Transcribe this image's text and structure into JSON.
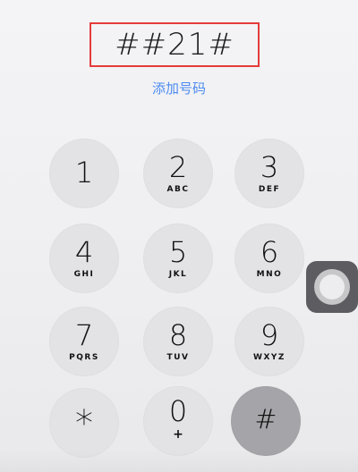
{
  "display": {
    "number": "##21#",
    "add_number_label": "添加号码"
  },
  "keypad": {
    "keys": [
      {
        "digit": "1",
        "letters": ""
      },
      {
        "digit": "2",
        "letters": "ABC"
      },
      {
        "digit": "3",
        "letters": "DEF"
      },
      {
        "digit": "4",
        "letters": "GHI"
      },
      {
        "digit": "5",
        "letters": "JKL"
      },
      {
        "digit": "6",
        "letters": "MNO"
      },
      {
        "digit": "7",
        "letters": "PQRS"
      },
      {
        "digit": "8",
        "letters": "TUV"
      },
      {
        "digit": "9",
        "letters": "WXYZ"
      },
      {
        "digit": "*",
        "letters": ""
      },
      {
        "digit": "0",
        "letters": "+"
      },
      {
        "digit": "#",
        "letters": ""
      }
    ]
  },
  "colors": {
    "highlight_border": "#e53b3b",
    "link_blue": "#4c8bf0",
    "key_bg": "#e3e3e6",
    "hash_key_bg": "#a5a5a9"
  },
  "icons": {
    "assistive_touch": "assistive-touch-icon"
  }
}
